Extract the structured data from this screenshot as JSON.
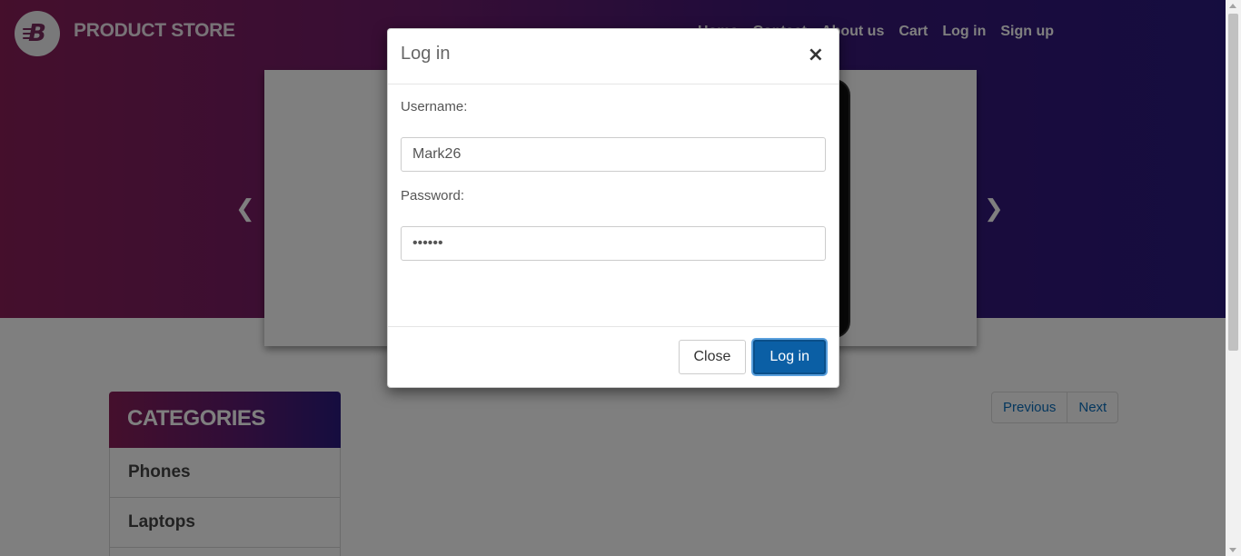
{
  "header": {
    "brand": "PRODUCT STORE",
    "logo_letter": "B",
    "nav": [
      "Home",
      "Contact",
      "About us",
      "Cart",
      "Log in",
      "Sign up"
    ]
  },
  "carousel": {
    "prev_icon": "chevron-left-icon",
    "next_icon": "chevron-right-icon"
  },
  "sidebar": {
    "title": "CATEGORIES",
    "items": [
      "Phones",
      "Laptops"
    ]
  },
  "pager": {
    "previous": "Previous",
    "next": "Next"
  },
  "modal": {
    "title": "Log in",
    "close_symbol": "×",
    "username_label": "Username:",
    "username_value": "Mark26",
    "password_label": "Password:",
    "password_value": "••••••",
    "close_button": "Close",
    "login_button": "Log in"
  },
  "colors": {
    "header_gradient_start": "#8a1f59",
    "header_gradient_end": "#2b1a7f",
    "primary_button": "#0b5fa5",
    "link": "#0a6ebd"
  }
}
